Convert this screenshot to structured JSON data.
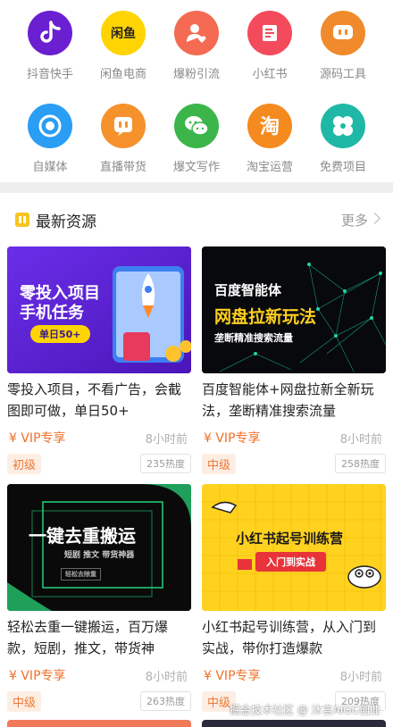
{
  "categories": [
    {
      "label": "抖音快手",
      "icon": "douyin-icon",
      "color": "#6a1fd1"
    },
    {
      "label": "闲鱼电商",
      "icon": "xianyu-icon",
      "color": "#ffd400"
    },
    {
      "label": "爆粉引流",
      "icon": "user-heart-icon",
      "color": "#f46a52"
    },
    {
      "label": "小红书",
      "icon": "book-icon",
      "color": "#f34b5c"
    },
    {
      "label": "源码工具",
      "icon": "code-tool-icon",
      "color": "#f08a2c"
    },
    {
      "label": "自媒体",
      "icon": "media-icon",
      "color": "#2a9df4"
    },
    {
      "label": "直播带货",
      "icon": "live-icon",
      "color": "#f5922c"
    },
    {
      "label": "爆文写作",
      "icon": "wechat-icon",
      "color": "#3bb54a"
    },
    {
      "label": "淘宝运营",
      "icon": "taobao-icon",
      "color": "#f58a1f"
    },
    {
      "label": "免费项目",
      "icon": "clover-icon",
      "color": "#1fb8a6"
    }
  ],
  "section": {
    "title": "最新资源",
    "more": "更多"
  },
  "cards": [
    {
      "thumb_title_1": "零投入项目",
      "thumb_title_2": "手机任务",
      "thumb_badge": "单日50+",
      "title": "零投入项目，不看广告，会截图即可做，单日50+",
      "price": "¥ VIP专享",
      "time": "8小时前",
      "level": "初级",
      "heat": "235热度"
    },
    {
      "thumb_title_1": "百度智能体",
      "thumb_title_2": "网盘拉新玩法",
      "thumb_badge": "垄断精准搜索流量",
      "title": "百度智能体+网盘拉新全新玩法，垄断精准搜索流量",
      "price": "¥ VIP专享",
      "time": "8小时前",
      "level": "中级",
      "heat": "258热度"
    },
    {
      "thumb_title_1": "一键去重搬运",
      "thumb_title_2": "短剧  推文  带货神器",
      "thumb_badge": "轻松去除重",
      "title": "轻松去重一键搬运，百万爆款，短剧，推文，带货神",
      "price": "¥ VIP专享",
      "time": "8小时前",
      "level": "中级",
      "heat": "263热度"
    },
    {
      "thumb_title_1": "小红书起号训练营",
      "thumb_title_2": "入门到实战",
      "thumb_badge": "",
      "title": "小红书起号训练营，从入门到实战，带你打造爆款",
      "price": "¥ VIP专享",
      "time": "8小时前",
      "level": "中级",
      "heat": "209热度"
    }
  ],
  "watermark": "掘金技术社区 @ 沐言AIGC创业"
}
